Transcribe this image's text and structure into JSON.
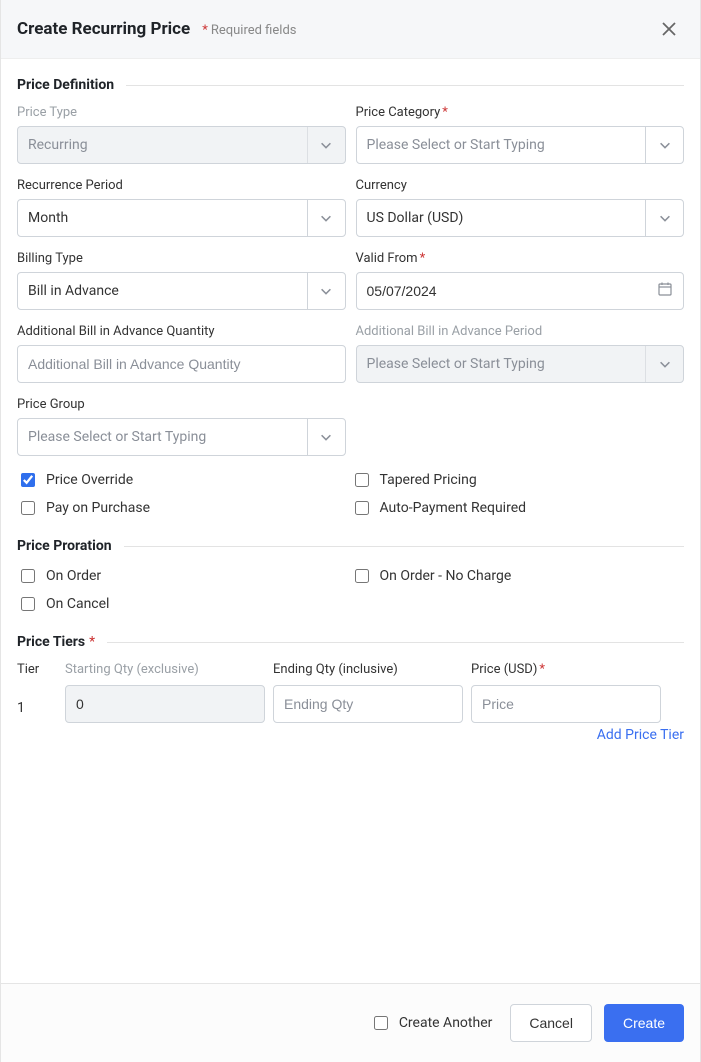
{
  "header": {
    "title": "Create Recurring Price",
    "required_note": "Required fields"
  },
  "sections": {
    "definition": "Price Definition",
    "proration": "Price Proration",
    "tiers": "Price Tiers"
  },
  "labels": {
    "price_type": "Price Type",
    "price_category": "Price Category",
    "recurrence_period": "Recurrence Period",
    "currency": "Currency",
    "billing_type": "Billing Type",
    "valid_from": "Valid From",
    "add_bia_qty": "Additional Bill in Advance Quantity",
    "add_bia_period": "Additional Bill in Advance Period",
    "price_group": "Price Group",
    "tier": "Tier",
    "start_qty": "Starting Qty (exclusive)",
    "end_qty": "Ending Qty (inclusive)",
    "price_usd": "Price (USD)"
  },
  "values": {
    "price_type": "Recurring",
    "recurrence_period": "Month",
    "currency": "US Dollar (USD)",
    "billing_type": "Bill in Advance",
    "valid_from": "05/07/2024",
    "tier_number": "1",
    "start_qty": "0"
  },
  "placeholders": {
    "select": "Please Select or Start Typing",
    "add_bia_qty": "Additional Bill in Advance Quantity",
    "end_qty": "Ending Qty",
    "price": "Price"
  },
  "checks": {
    "price_override": "Price Override",
    "tapered_pricing": "Tapered Pricing",
    "pay_on_purchase": "Pay on Purchase",
    "auto_payment_required": "Auto-Payment Required",
    "on_order": "On Order",
    "on_order_no_charge": "On Order - No Charge",
    "on_cancel": "On Cancel",
    "create_another": "Create Another"
  },
  "links": {
    "add_tier": "Add Price Tier"
  },
  "buttons": {
    "cancel": "Cancel",
    "create": "Create"
  }
}
